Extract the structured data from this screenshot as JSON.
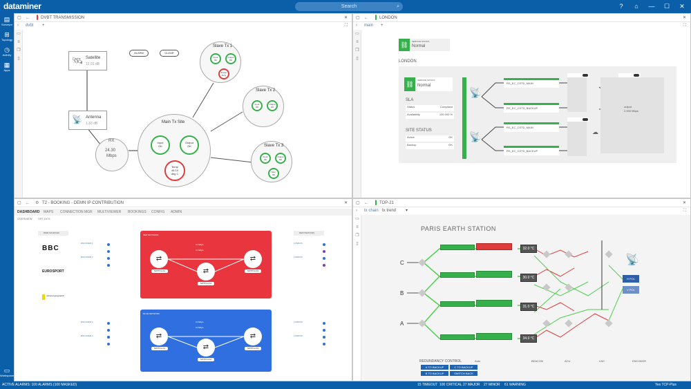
{
  "app": {
    "brand": "dataminer",
    "search_placeholder": "Search"
  },
  "window_controls": [
    "?",
    "⌂",
    "—",
    "☐",
    "✕"
  ],
  "leftnav": [
    {
      "label": "Surveyor",
      "icon": "surveyor-icon",
      "glyph": "▤"
    },
    {
      "label": "Topology",
      "icon": "topology-icon",
      "glyph": "⊞"
    },
    {
      "label": "Activity",
      "icon": "activity-icon",
      "glyph": "◷"
    },
    {
      "label": "Apps",
      "icon": "apps-icon",
      "glyph": "▦"
    },
    {
      "label": "Workspace",
      "icon": "workspace-icon",
      "glyph": "▭"
    }
  ],
  "status": {
    "left": "ACTIVE ALARMS: 100 ALARMS (100 MASKED)",
    "badges": [
      "15 TIMEOUT",
      "100 CRITICAL",
      "27 MAJOR",
      "27 MINOR",
      "61 WARNING"
    ],
    "right": "Yes TCP-Plus"
  },
  "panels": {
    "p1": {
      "title": "DVBT TRANSMISSION",
      "tab": "dvbt",
      "alarm_btn": "ALARM",
      "clear_btn": "CLEAR",
      "satellite": {
        "name": "Satellite",
        "sub": "12.01 dB"
      },
      "antenna": {
        "name": "Antenna",
        "sub": "1.33 dB"
      },
      "rx": {
        "name": "RX",
        "value": "24.30",
        "unit": "Mbps"
      },
      "main_site": {
        "name": "Main Tx Site",
        "input": "Input",
        "output": "Output",
        "ok": "OK",
        "temp": "Temp",
        "temp_val": "46.10",
        "temp_unit": "deg C"
      },
      "slave1": {
        "name": "Slave Tx 1",
        "input": "Input",
        "output": "Output",
        "ok": "OK",
        "power": "Power",
        "power_val": "Defy"
      },
      "slave2": {
        "name": "Slave Tx 2",
        "input": "Input",
        "output": "Output",
        "ok": "OK"
      },
      "slave3": {
        "name": "Slave Tx 3",
        "input": "Input",
        "output": "Output",
        "ok": "OK",
        "mux": "Mux",
        "mux_val": "OK"
      }
    },
    "p2": {
      "title": "LONDON",
      "tab": "main",
      "service_label": "SERVICE STATUS",
      "service_value": "Normal",
      "site": "LONDON",
      "sla_title": "SLA",
      "sla_rows": [
        [
          "Status",
          "Compliant"
        ],
        [
          "Availability",
          "100.000 %"
        ]
      ],
      "site_status_title": "SITE STATUS",
      "site_rows": [
        [
          "Active",
          "OK"
        ],
        [
          "Backup",
          "OK"
        ]
      ],
      "chains": [
        "RS_EC_CSTD_MAIN",
        "RS_EC_CSTD_BACKUP",
        "RS_EC_CSTD_MAIN",
        "RS_EC_CSTD_BACKUP"
      ],
      "output_label": "output",
      "output_val": "2.000 Mbps"
    },
    "p3": {
      "title": "T2 - BOOKING - DEMN IP CONTRIBUTION",
      "tabs": [
        "DASHBOARD",
        "MAPS",
        "CONNECTION MGR",
        "MULTIVIEWER",
        "BOOKINGS",
        "CONFIG",
        "ADMIN"
      ],
      "subtabs": [
        "OVERVIEW",
        "SRT-DCS"
      ],
      "sources_title": "DMM SOURCES",
      "dest_title": "DESTINATIONS",
      "sources": [
        "BBC",
        "EUROSPORT",
        "national geographic"
      ],
      "red_title": "RED NETWORK",
      "blue_title": "BLUE NETWORK",
      "rate1": "10 Mbps",
      "rate2": "10 Mbps",
      "switch_labels": [
        "SWITCH A1",
        "SWITCH A2",
        "SWITCH A3"
      ],
      "rx_labels": [
        "ENCODER 1",
        "ENCODER 2",
        "ENCODER 3",
        "ENCODER 4"
      ],
      "dest_labels": [
        "LONDON",
        "LONDON",
        "LONDON",
        "LONDON"
      ]
    },
    "p4": {
      "title": "TOP-21",
      "tabs": [
        "tx chain",
        "tx trend"
      ],
      "station": "PARIS EARTH STATION",
      "row_labels": [
        "C",
        "B",
        "A"
      ],
      "temps": [
        "32.0 °C",
        "30.0 °C",
        "31.0 °C",
        "34.0 °C"
      ],
      "redundancy_title": "REDUNDANCY CONTROL",
      "mode": "Auto",
      "red_btns": [
        "A TO BACKUP",
        "C TO BACKUP",
        "B TO BACKUP",
        "SWITCH BACK"
      ],
      "beacon_title": "BEACON",
      "acu_title": "ACU",
      "lnc_title": "LNC",
      "encoder_title": "ENCODER",
      "pol": [
        "H POL",
        "V POL"
      ]
    }
  }
}
